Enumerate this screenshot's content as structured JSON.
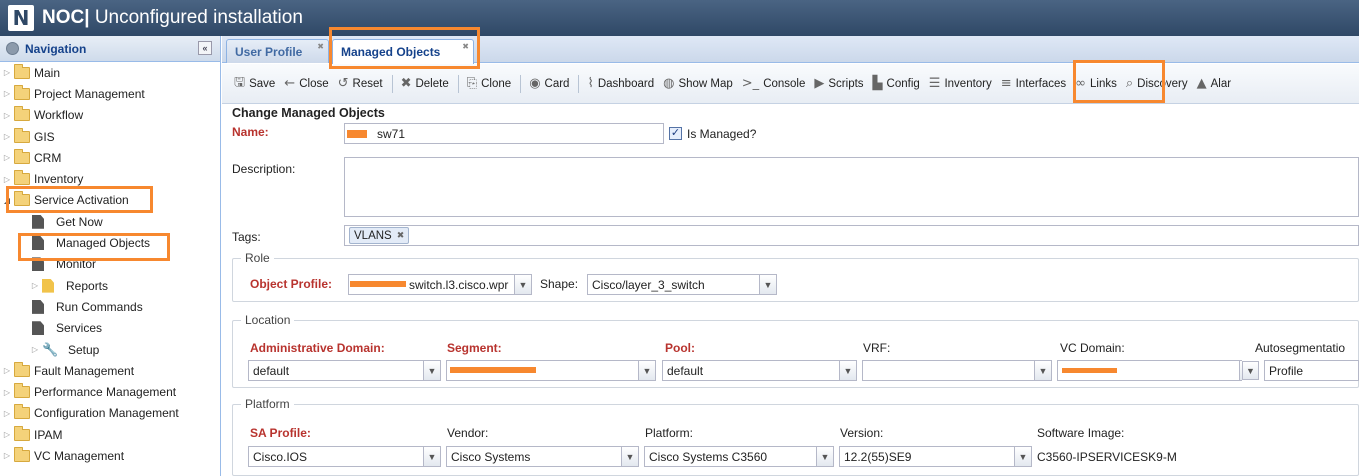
{
  "app": {
    "logo": "N",
    "title_bold": "NOC|",
    "title_rest": "Unconfigured installation"
  },
  "nav": {
    "title": "Navigation",
    "collapse": "«",
    "items": [
      {
        "label": "Main",
        "kind": "folder"
      },
      {
        "label": "Project Management",
        "kind": "folder"
      },
      {
        "label": "Workflow",
        "kind": "folder"
      },
      {
        "label": "GIS",
        "kind": "folder"
      },
      {
        "label": "CRM",
        "kind": "folder"
      },
      {
        "label": "Inventory",
        "kind": "folder"
      },
      {
        "label": "Service Activation",
        "kind": "folder-open"
      },
      {
        "label": "Get Now",
        "kind": "leaf"
      },
      {
        "label": "Managed Objects",
        "kind": "leaf"
      },
      {
        "label": "Monitor",
        "kind": "leaf"
      },
      {
        "label": "Reports",
        "kind": "report"
      },
      {
        "label": "Run Commands",
        "kind": "leaf"
      },
      {
        "label": "Services",
        "kind": "leaf"
      },
      {
        "label": "Setup",
        "kind": "wrench"
      },
      {
        "label": "Fault Management",
        "kind": "folder"
      },
      {
        "label": "Performance Management",
        "kind": "folder"
      },
      {
        "label": "Configuration Management",
        "kind": "folder"
      },
      {
        "label": "IPAM",
        "kind": "folder"
      },
      {
        "label": "VC Management",
        "kind": "folder"
      }
    ]
  },
  "tabs": [
    {
      "label": "User Profile",
      "active": false
    },
    {
      "label": "Managed Objects",
      "active": true
    }
  ],
  "toolbar": [
    {
      "icon": "save-icon",
      "glyph": "🖫",
      "label": "Save"
    },
    {
      "icon": "close-icon",
      "glyph": "←",
      "label": "Close"
    },
    {
      "icon": "reset-icon",
      "glyph": "↺",
      "label": "Reset"
    },
    {
      "icon": "delete-icon",
      "glyph": "✖",
      "label": "Delete"
    },
    {
      "icon": "clone-icon",
      "glyph": "⎘",
      "label": "Clone"
    },
    {
      "icon": "card-icon",
      "glyph": "◉",
      "label": "Card"
    },
    {
      "icon": "dashboard-icon",
      "glyph": "⌇",
      "label": "Dashboard"
    },
    {
      "icon": "map-icon",
      "glyph": "◍",
      "label": "Show Map"
    },
    {
      "icon": "console-icon",
      "glyph": ">_",
      "label": "Console"
    },
    {
      "icon": "scripts-icon",
      "glyph": "▶",
      "label": "Scripts"
    },
    {
      "icon": "config-icon",
      "glyph": "▙",
      "label": "Config"
    },
    {
      "icon": "inventory-icon",
      "glyph": "☰",
      "label": "Inventory"
    },
    {
      "icon": "interfaces-icon",
      "glyph": "≡",
      "label": "Interfaces"
    },
    {
      "icon": "links-icon",
      "glyph": "∞",
      "label": "Links"
    },
    {
      "icon": "discovery-icon",
      "glyph": "⌕",
      "label": "Discovery"
    },
    {
      "icon": "alarm-icon",
      "glyph": "▲",
      "label": "Alar"
    }
  ],
  "form": {
    "title": "Change Managed Objects",
    "name_label": "Name:",
    "name_value": "sw71",
    "is_managed_label": "Is Managed?",
    "is_managed_check": "✓",
    "description_label": "Description:",
    "tags_label": "Tags:",
    "tag": "VLANS",
    "tag_close": "✖",
    "role_legend": "Role",
    "object_profile_label": "Object Profile:",
    "object_profile_value": "switch.l3.cisco.wpr",
    "shape_label": "Shape:",
    "shape_value": "Cisco/layer_3_switch",
    "location_legend": "Location",
    "admin_domain_label": "Administrative Domain:",
    "admin_domain_value": "default",
    "segment_label": "Segment:",
    "pool_label": "Pool:",
    "pool_value": "default",
    "vrf_label": "VRF:",
    "vc_domain_label": "VC Domain:",
    "autoseg_label": "Autosegmentatio",
    "autoseg_value": "Profile",
    "platform_legend": "Platform",
    "sa_profile_label": "SA Profile:",
    "sa_profile_value": "Cisco.IOS",
    "vendor_label": "Vendor:",
    "vendor_value": "Cisco Systems",
    "platform_label": "Platform:",
    "platform_value": "Cisco Systems C3560",
    "version_label": "Version:",
    "version_value": "12.2(55)SE9",
    "software_image_label": "Software Image:",
    "software_image_value": "C3560-IPSERVICESK9-M"
  },
  "colors": {
    "highlight": "#f7882f",
    "required": "#b8332e",
    "topbar": "#2f4866"
  }
}
